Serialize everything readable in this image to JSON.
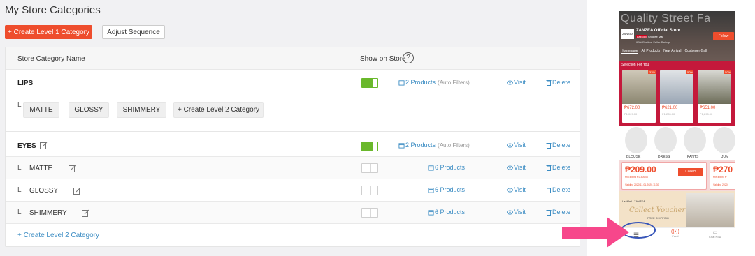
{
  "page": {
    "title": "My Store Categories"
  },
  "toolbar": {
    "create_l1": "+ Create Level 1 Category",
    "adjust": "Adjust Sequence"
  },
  "table": {
    "col_name": "Store Category Name",
    "col_show": "Show on Store",
    "help": "?"
  },
  "lips": {
    "name": "LIPS",
    "enabled": true,
    "products": "2 Products",
    "filters": "(Auto Filters)",
    "visit": "Visit",
    "delete": "Delete",
    "elbow": "L",
    "chips": [
      "MATTE",
      "GLOSSY",
      "SHIMMERY"
    ],
    "create_l2": "+ Create Level 2 Category"
  },
  "eyes": {
    "name": "EYES",
    "enabled": true,
    "products": "2 Products",
    "filters": "(Auto Filters)",
    "visit": "Visit",
    "delete": "Delete",
    "subs": [
      {
        "elbow": "L",
        "name": "MATTE",
        "enabled": false,
        "products": "6 Products",
        "visit": "Visit",
        "delete": "Delete"
      },
      {
        "elbow": "L",
        "name": "GLOSSY",
        "enabled": false,
        "products": "6 Products",
        "visit": "Visit",
        "delete": "Delete"
      },
      {
        "elbow": "L",
        "name": "SHIMMERY",
        "enabled": false,
        "products": "6 Products",
        "visit": "Visit",
        "delete": "Delete"
      }
    ],
    "create_l2": "+ Create Level 2 Category"
  },
  "phone": {
    "watermark": "Quality Street Fa",
    "logo": "ZANZEA",
    "store_name": "ZANZEA Official Store",
    "mall_badge": "LazMall",
    "mall_text": "Shopee Mall",
    "rating": "99% Positive Seller Ratings",
    "follow": "Follow",
    "tabs": [
      "Homepage",
      "All Products",
      "New Arrival",
      "Customer Gall"
    ],
    "selection_title": "Selection For You",
    "products": [
      {
        "price": "₱672.00",
        "old": "₱1,007.00",
        "disc": "-33%"
      },
      {
        "price": "₱621.00",
        "old": "₱1,235.00",
        "disc": "-50%"
      },
      {
        "price": "₱651.00",
        "old": "₱1,295.00",
        "disc": "-50%"
      }
    ],
    "categories": [
      "BLOUSE",
      "DRESS",
      "PANTS",
      "JUM"
    ],
    "vouchers": [
      {
        "amount": "₱209.00",
        "min_spend": "Min.spend ₱2,300.00",
        "validity": "Validity: 2020.11.01-2020.11.30",
        "collect": "Collect"
      },
      {
        "amount": "₱270",
        "min_spend": "Min.spend ₱",
        "validity": "Validity: 2020"
      }
    ],
    "banner": {
      "brand": "LazMall | ZANZEA",
      "script": "Collect Voucher",
      "shipping": "FREE SHIPPING"
    },
    "nav": [
      "",
      "Feed",
      "Chat Now"
    ]
  },
  "colors": {
    "accent": "#ee4d2d",
    "link": "#3b8cc3",
    "toggle_on": "#6ab82c",
    "arrow": "#f7478b",
    "highlight": "#3654b8"
  }
}
